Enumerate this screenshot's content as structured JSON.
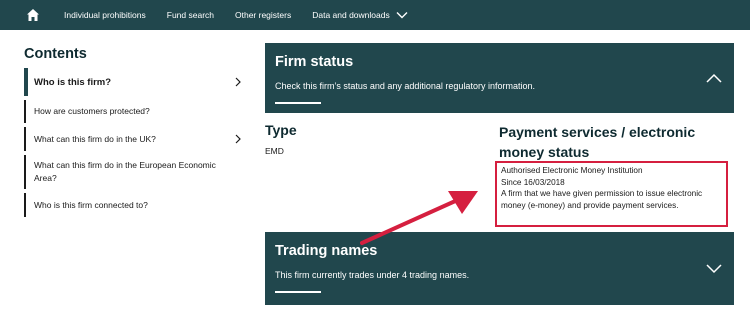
{
  "nav": {
    "home_icon": "home-icon",
    "items": [
      "Individual prohibitions",
      "Fund search",
      "Other registers",
      "Data and downloads"
    ],
    "dropdown_icon": "chevron-down-icon",
    "background": "#21474d"
  },
  "contents": {
    "title": "Contents",
    "items": [
      {
        "label": "Who is this firm?",
        "active": true,
        "has_arrow": true
      },
      {
        "label": "How are customers protected?",
        "active": false,
        "has_arrow": false
      },
      {
        "label": "What can this firm do in the UK?",
        "active": false,
        "has_arrow": true
      },
      {
        "label": "What can this firm do in the European Economic Area?",
        "active": false,
        "has_arrow": false
      },
      {
        "label": "Who is this firm connected to?",
        "active": false,
        "has_arrow": false
      }
    ]
  },
  "firm_status": {
    "title": "Firm status",
    "description": "Check this firm’s status and any additional regulatory information.",
    "toggle_icon": "chevron-up-icon"
  },
  "type": {
    "label": "Type",
    "value": "EMD"
  },
  "payment": {
    "label": "Payment services / electronic money status",
    "lines": [
      "Authorised Electronic Money Institution",
      "Since 16/03/2018",
      "A firm that we have given permission to issue electronic money (e-money) and provide payment services."
    ],
    "highlight_color": "#d51f3f"
  },
  "trading": {
    "title": "Trading names",
    "description": "This firm currently trades under 4 trading names.",
    "toggle_icon": "chevron-down-icon"
  },
  "colors": {
    "panel": "#21474d",
    "accent": "#d51f3f"
  }
}
